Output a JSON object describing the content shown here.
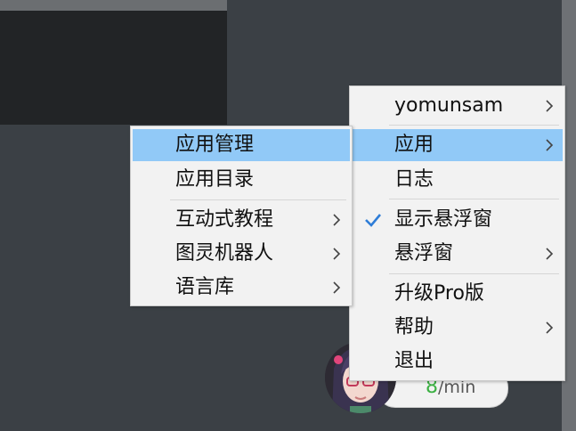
{
  "widget": {
    "speed_value": "8",
    "speed_unit": "/min"
  },
  "main_menu": {
    "items": [
      {
        "label": "yomunsam",
        "submenu": true
      },
      {
        "label": "应用",
        "submenu": true,
        "highlighted": true
      },
      {
        "label": "日志"
      },
      {
        "label": "显示悬浮窗",
        "checked": true
      },
      {
        "label": "悬浮窗",
        "submenu": true
      },
      {
        "label": "升级Pro版"
      },
      {
        "label": "帮助",
        "submenu": true
      },
      {
        "label": "退出"
      }
    ]
  },
  "sub_menu": {
    "items": [
      {
        "label": "应用管理",
        "highlighted": true
      },
      {
        "label": "应用目录"
      },
      {
        "label": "互动式教程",
        "submenu": true
      },
      {
        "label": "图灵机器人",
        "submenu": true
      },
      {
        "label": "语言库",
        "submenu": true
      }
    ]
  },
  "colors": {
    "highlight": "#91c9f7",
    "menu_bg": "#f2f2f2",
    "check": "#2e7dd7",
    "speed_number": "#3cb043"
  },
  "icons": {
    "submenu_arrow": "chevron-right-icon",
    "check": "check-icon"
  }
}
